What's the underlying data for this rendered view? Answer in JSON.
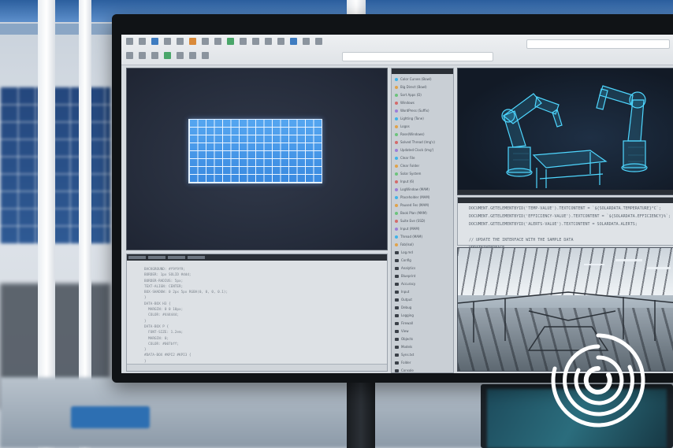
{
  "scene": {
    "colors": {
      "accent_blue": "#3a8ae0",
      "robot_cyan": "#3fd0ff",
      "screen_bg": "#d6dbe0",
      "viewport_bg": "#252c3b"
    }
  },
  "file_list": {
    "items": [
      {
        "label": "Color Curves (Bowl)",
        "icon": "node-icon"
      },
      {
        "label": "Big Direct (Bowl)",
        "icon": "node-icon"
      },
      {
        "label": "Sort Apps (D)",
        "icon": "node-icon"
      },
      {
        "label": "Windows",
        "icon": "node-icon"
      },
      {
        "label": "WordPress (Suffix)",
        "icon": "node-icon"
      },
      {
        "label": "Lighting (Tone)",
        "icon": "node-icon"
      },
      {
        "label": "Logos",
        "icon": "node-icon"
      },
      {
        "label": "Rose(Windows)",
        "icon": "node-icon"
      },
      {
        "label": "Solved Thread (Img's)",
        "icon": "node-icon"
      },
      {
        "label": "Updated Clock (Img')",
        "icon": "node-icon"
      },
      {
        "label": "Clear File",
        "icon": "node-icon"
      },
      {
        "label": "Clear Folder",
        "icon": "node-icon"
      },
      {
        "label": "Solar System",
        "icon": "node-icon"
      },
      {
        "label": "Input (6)",
        "icon": "node-icon"
      },
      {
        "label": "LogWindow (MAM)",
        "icon": "node-icon"
      },
      {
        "label": "Placeholder (MAM)",
        "icon": "node-icon"
      },
      {
        "label": "Paused Fes (MAM)",
        "icon": "node-icon"
      },
      {
        "label": "Book Plan (MAM)",
        "icon": "node-icon"
      },
      {
        "label": "Suite Eve (SSD)",
        "icon": "node-icon"
      },
      {
        "label": "Input (MAM)",
        "icon": "node-icon"
      },
      {
        "label": "Thread (MAM)",
        "icon": "node-icon"
      },
      {
        "label": "Fab(Isol)",
        "icon": "node-icon"
      },
      {
        "label": "Log.md",
        "icon": "folder-icon"
      },
      {
        "label": "Config",
        "icon": "folder-icon"
      },
      {
        "label": "Analytics",
        "icon": "folder-icon"
      },
      {
        "label": "Blueprint",
        "icon": "folder-icon"
      },
      {
        "label": "Accuracy",
        "icon": "folder-icon"
      },
      {
        "label": "Input",
        "icon": "folder-icon"
      },
      {
        "label": "Output",
        "icon": "folder-icon"
      },
      {
        "label": "Debug",
        "icon": "folder-icon"
      },
      {
        "label": "Logging",
        "icon": "folder-icon"
      },
      {
        "label": "Firewall",
        "icon": "folder-icon"
      },
      {
        "label": "View",
        "icon": "folder-icon"
      },
      {
        "label": "Objects",
        "icon": "folder-icon"
      },
      {
        "label": "Models",
        "icon": "folder-icon"
      },
      {
        "label": "Syns.txt",
        "icon": "folder-icon"
      },
      {
        "label": "Folder",
        "icon": "folder-icon"
      },
      {
        "label": "Console",
        "icon": "folder-icon"
      }
    ]
  },
  "right_code": {
    "lines": [
      "DOCUMENT.GETELEMENTBYID('TEMP-VALUE').TEXTCONTENT = `${SOLARDATA.TEMPERATURE}°C`;",
      "DOCUMENT.GETELEMENTBYID('EFFICIENCY-VALUE').TEXTCONTENT = `${SOLARDATA.EFFICIENCY}%`;",
      "DOCUMENT.GETELEMENTBYID('ALERTS-VALUE').TEXTCONTENT = SOLARDATA.ALERTS;",
      "",
      "// UPDATE THE INTERFACE WITH THE SAMPLE DATA",
      "UPDATEINTERFACE"
    ]
  },
  "left_code": {
    "lines": [
      "BACKGROUND: #f9f9f9;",
      "BORDER: 1px SOLID #ddd;",
      "BORDER-RADIUS: 5px;",
      "TEXT-ALIGN: CENTER;",
      "BOX-SHADOW: 0 2px 5px RGBA(0, 0, 0, 0.1);",
      "}",
      "DATA-BOX H3 {",
      "  MARGIN: 0 0 10px;",
      "  COLOR: #444444;",
      "}",
      "DATA-BOX P {",
      "  FONT-SIZE: 1.2em;",
      "  MARGIN: 0;",
      "  COLOR: #007bff;",
      "}",
      "#DATA-BOX #KPI2 #KPI3 {",
      "}"
    ]
  }
}
